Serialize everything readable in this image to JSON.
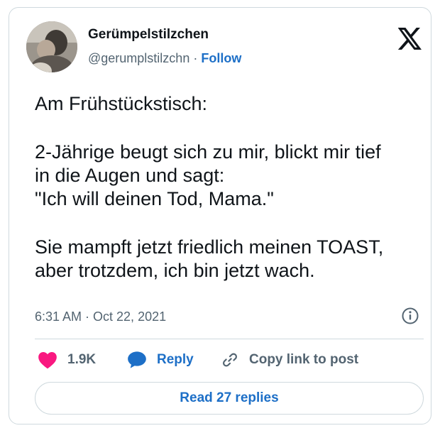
{
  "author": {
    "display_name": "Gerümpelstilzchen",
    "handle": "@gerumplstilzchn",
    "separator": "·",
    "follow_label": "Follow"
  },
  "tweet": {
    "lines": [
      "Am Frühstückstisch:",
      "2-Jährige beugt sich zu mir, blickt mir tief",
      "in die Augen und sagt:",
      "\"Ich will deinen Tod, Mama.\"",
      "Sie mampft jetzt friedlich meinen TOAST,",
      "aber trotzdem, ich bin jetzt wach."
    ],
    "timestamp": "6:31 AM · Oct 22, 2021"
  },
  "actions": {
    "likes": "1.9K",
    "reply_label": "Reply",
    "copy_label": "Copy link to post"
  },
  "read_replies_label": "Read 27 replies",
  "icons": {
    "brand": "x-logo-icon",
    "info": "info-icon",
    "like": "heart-icon",
    "reply": "speech-bubble-icon",
    "copy": "link-icon"
  },
  "colors": {
    "accent": "#1d6fc7",
    "like": "#f91880",
    "muted": "#536471",
    "border": "#cfd9de"
  }
}
